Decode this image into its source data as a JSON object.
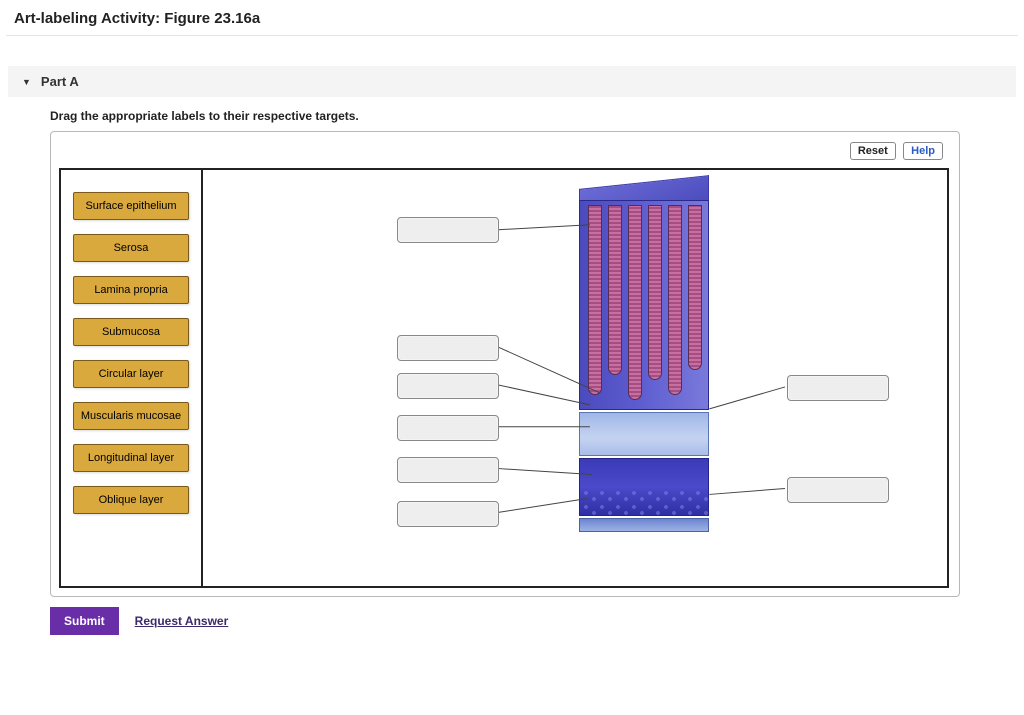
{
  "title": "Art-labeling Activity: Figure 23.16a",
  "part": {
    "label": "Part A"
  },
  "instructions": "Drag the appropriate labels to their respective targets.",
  "toolbar": {
    "reset": "Reset",
    "help": "Help"
  },
  "labels": [
    "Surface epithelium",
    "Serosa",
    "Lamina propria",
    "Submucosa",
    "Circular layer",
    "Muscularis mucosae",
    "Longitudinal layer",
    "Oblique layer"
  ],
  "actions": {
    "submit": "Submit",
    "request": "Request Answer"
  }
}
